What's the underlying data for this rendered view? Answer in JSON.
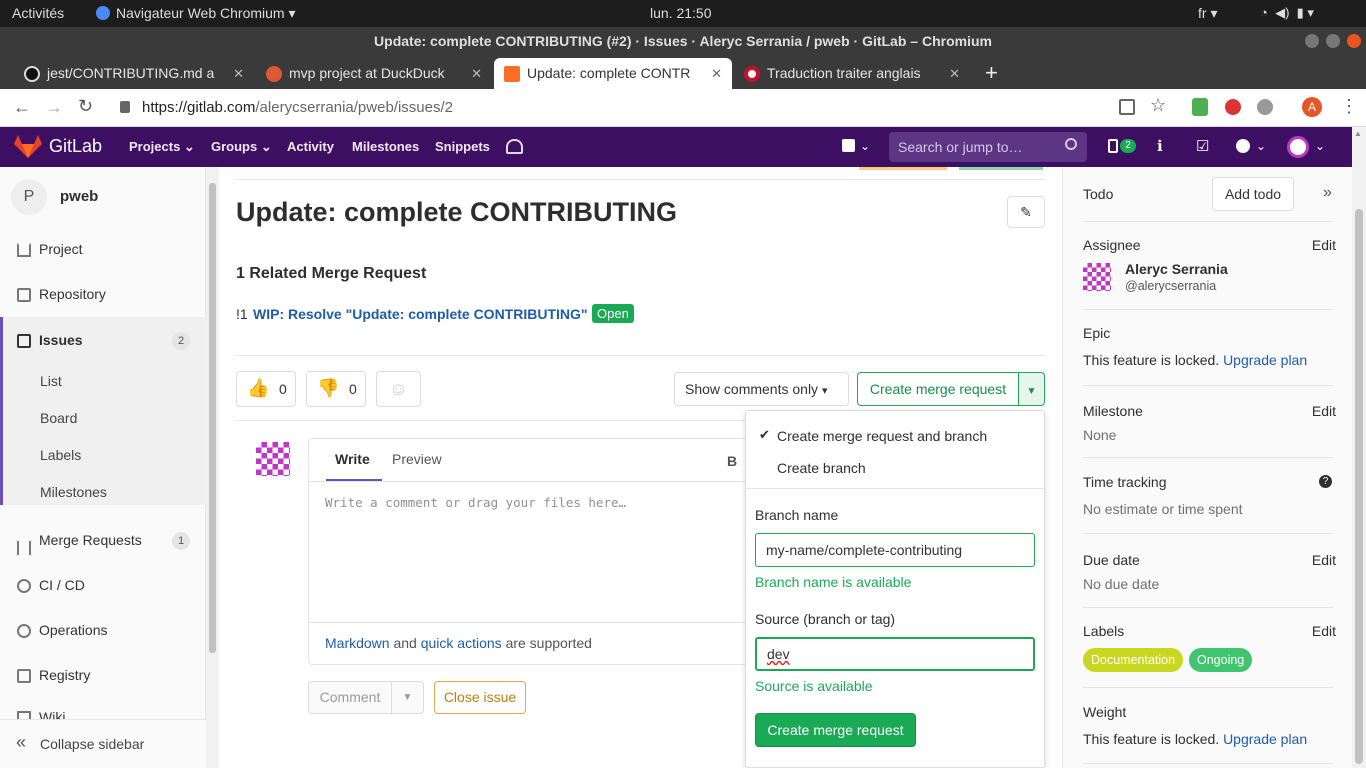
{
  "os": {
    "activities": "Activités",
    "browser_menu": "Navigateur Web Chromium",
    "clock": "lun. 21:50",
    "lang": "fr"
  },
  "window": {
    "title": "Update: complete CONTRIBUTING (#2) · Issues · Aleryc Serrania / pweb · GitLab – Chromium"
  },
  "tabs": [
    {
      "label": "jest/CONTRIBUTING.md a"
    },
    {
      "label": "mvp project at DuckDuck"
    },
    {
      "label": "Update: complete CONTR"
    },
    {
      "label": "Traduction traiter anglais"
    }
  ],
  "address": {
    "url_host": "https://gitlab.com",
    "url_path": "/alerycserrania/pweb/issues/2",
    "profile_initial": "A"
  },
  "gitlab_nav": {
    "brand": "GitLab",
    "projects": "Projects",
    "groups": "Groups",
    "activity": "Activity",
    "milestones": "Milestones",
    "snippets": "Snippets",
    "search_placeholder": "Search or jump to…",
    "issues_count": "2"
  },
  "sidebar": {
    "project_initial": "P",
    "project_name": "pweb",
    "project": "Project",
    "repository": "Repository",
    "issues": "Issues",
    "issues_count": "2",
    "sub": [
      "List",
      "Board",
      "Labels",
      "Milestones"
    ],
    "merge_requests": "Merge Requests",
    "mr_count": "1",
    "cicd": "CI / CD",
    "operations": "Operations",
    "registry": "Registry",
    "wiki": "Wiki",
    "collapse": "Collapse sidebar"
  },
  "issue": {
    "title": "Update: complete CONTRIBUTING",
    "related_heading": "1 Related Merge Request",
    "mr_ref": "!1",
    "mr_title": "WIP: Resolve \"Update: complete CONTRIBUTING\"",
    "mr_status": "Open",
    "thumbs_up": "0",
    "thumbs_down": "0",
    "show_comments": "Show comments only",
    "create_mr": "Create merge request"
  },
  "comment": {
    "write_tab": "Write",
    "preview_tab": "Preview",
    "bold": "B",
    "placeholder": "Write a comment or drag your files here…",
    "markdown": "Markdown",
    "and": "and",
    "quick_actions": "quick actions",
    "supported": "are supported",
    "comment_btn": "Comment",
    "close_issue": "Close issue"
  },
  "dropdown": {
    "option1": "Create merge request and branch",
    "option2": "Create branch",
    "branch_label": "Branch name",
    "branch_value": "my-name/complete-contributing",
    "branch_ok": "Branch name is available",
    "source_label": "Source (branch or tag)",
    "source_value": "dev",
    "source_ok": "Source is available",
    "submit": "Create merge request"
  },
  "right_sidebar": {
    "todo": "Todo",
    "add_todo": "Add todo",
    "assignee": "Assignee",
    "edit": "Edit",
    "assignee_name": "Aleryc Serrania",
    "assignee_user": "@alerycserrania",
    "epic": "Epic",
    "locked": "This feature is locked.",
    "upgrade": "Upgrade plan",
    "milestone": "Milestone",
    "none": "None",
    "time_tracking": "Time tracking",
    "no_estimate": "No estimate or time spent",
    "due_date": "Due date",
    "no_due": "No due date",
    "labels": "Labels",
    "label_items": [
      "Documentation",
      "Ongoing"
    ],
    "weight": "Weight"
  },
  "colors": {
    "nav": "#3d0f63",
    "success": "#1aaa55",
    "link": "#1f78d1",
    "label_doc": "#c8d71f",
    "label_ongoing": "#40c46f"
  }
}
